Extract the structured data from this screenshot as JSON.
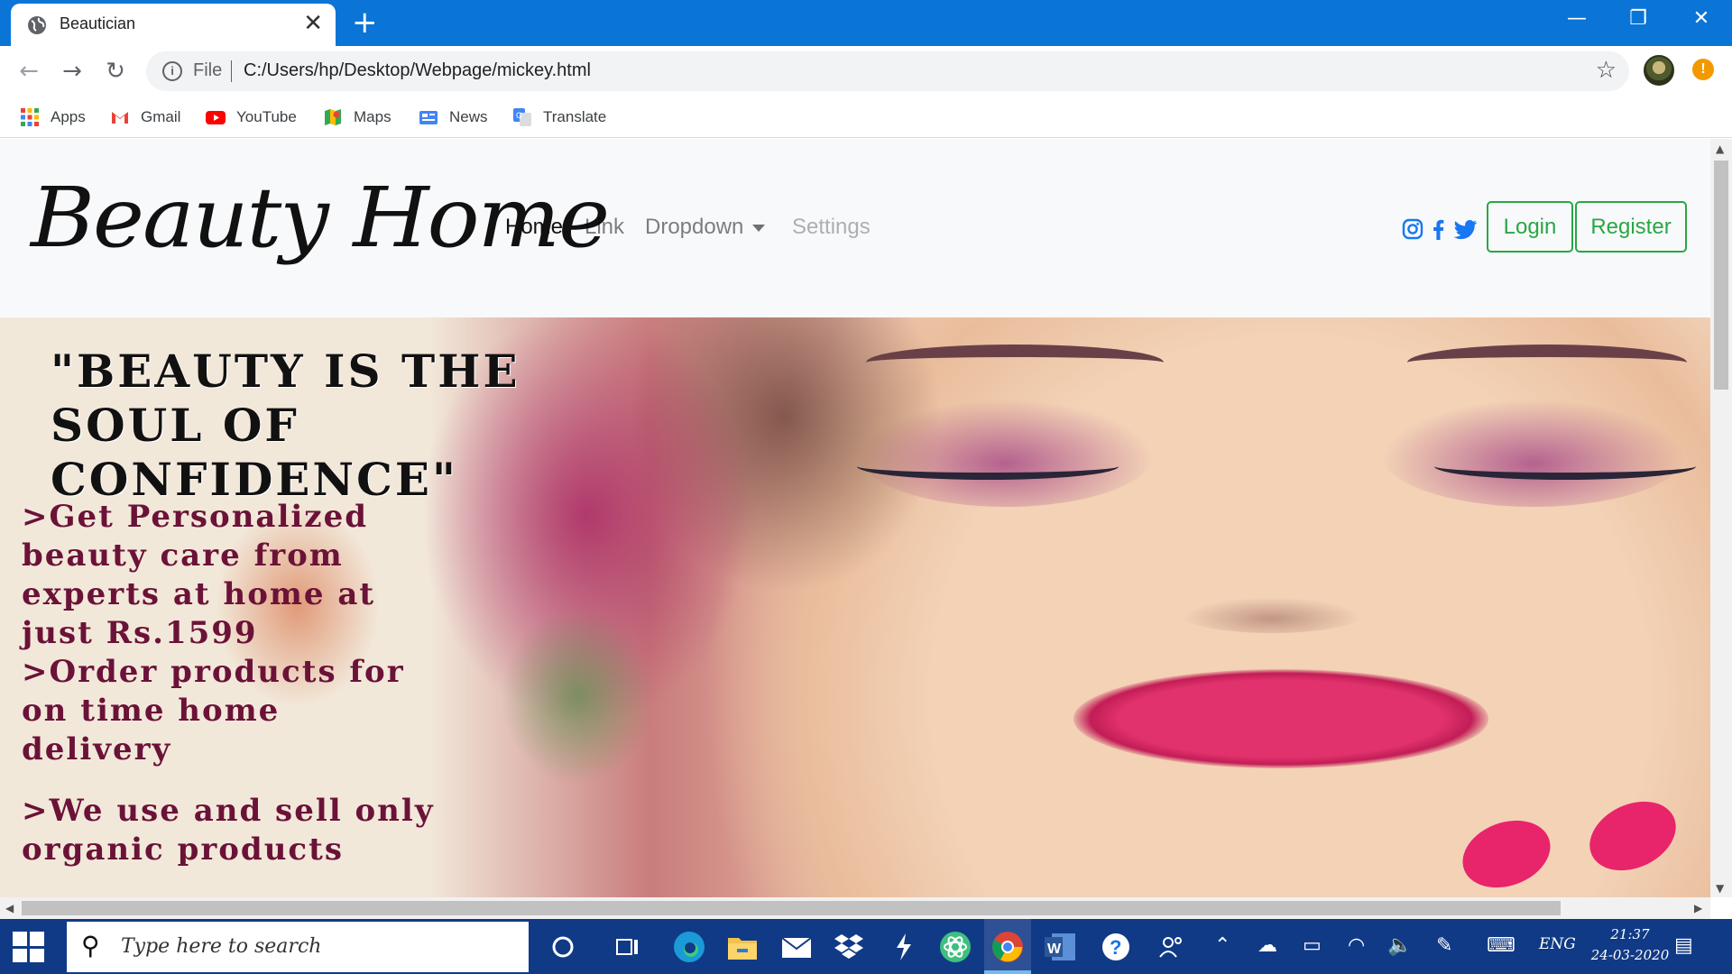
{
  "browser": {
    "tab_title": "Beautician",
    "new_tab_glyph": "+",
    "close_glyph": "✕",
    "window_controls": {
      "minimize": "—",
      "restore": "❐",
      "close": "✕"
    },
    "address": {
      "scheme_label": "File",
      "url": "C:/Users/hp/Desktop/Webpage/mickey.html"
    },
    "bookmarks": [
      {
        "label": "Apps",
        "icon": "apps-grid-icon"
      },
      {
        "label": "Gmail",
        "icon": "gmail-icon"
      },
      {
        "label": "YouTube",
        "icon": "youtube-icon"
      },
      {
        "label": "Maps",
        "icon": "maps-icon"
      },
      {
        "label": "News",
        "icon": "news-icon"
      },
      {
        "label": "Translate",
        "icon": "translate-icon"
      }
    ]
  },
  "site": {
    "brand": "Beauty Home",
    "nav": [
      {
        "label": "Home",
        "state": "active"
      },
      {
        "label": "Link",
        "state": "normal"
      },
      {
        "label": "Dropdown",
        "state": "normal"
      },
      {
        "label": "Settings",
        "state": "disabled"
      }
    ],
    "social": [
      "instagram-icon",
      "facebook-icon",
      "twitter-icon"
    ],
    "buttons": {
      "login": "Login",
      "register": "Register"
    },
    "hero": {
      "quote": "\"BEAUTY IS THE SOUL OF CONFIDENCE\"",
      "lines": [
        ">Get Personalized",
        "beauty care from",
        "experts at home at",
        "just Rs.1599",
        ">Order products for",
        "on time home",
        "delivery",
        " >We use and sell only",
        "organic products"
      ]
    }
  },
  "taskbar": {
    "search_placeholder": "Type here to search",
    "language": "ENG",
    "time": "21:37",
    "date": "24-03-2020"
  },
  "colors": {
    "accent_blue": "#0a75d6",
    "success_green": "#28a745",
    "taskbar": "#103a86",
    "hero_text": "#6b1238"
  }
}
